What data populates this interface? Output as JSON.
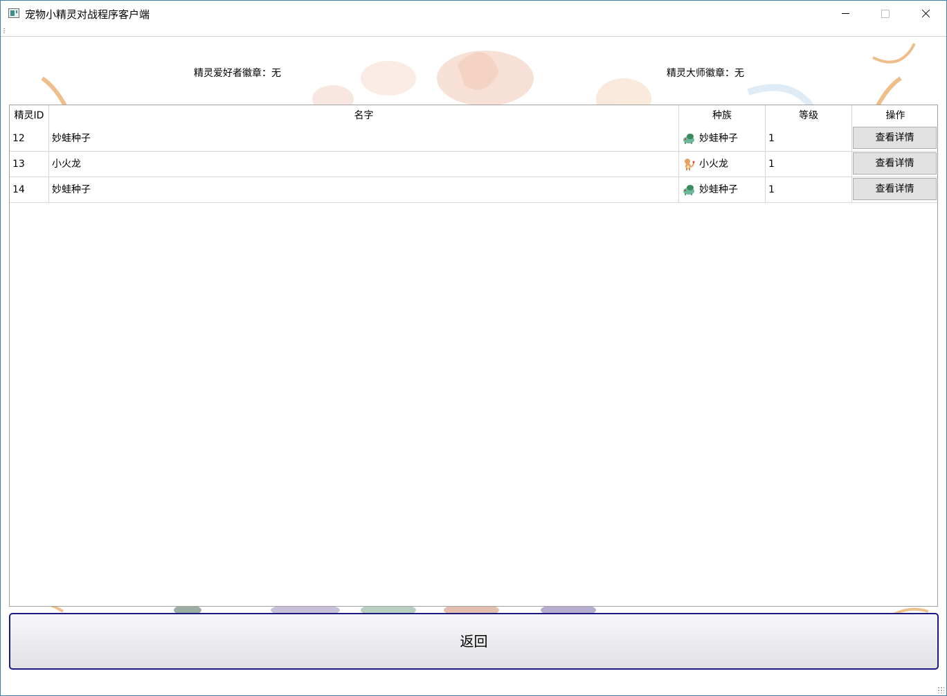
{
  "window": {
    "title": "宠物小精灵对战程序客户端"
  },
  "badges": {
    "fan": "精灵爱好者徽章：无",
    "master": "精灵大师徽章：无"
  },
  "table": {
    "columns": [
      "精灵ID",
      "名字",
      "种族",
      "等级",
      "操作"
    ],
    "rows": [
      {
        "id": "12",
        "name": "妙蛙种子",
        "race": "妙蛙种子",
        "race_icon": "bulbasaur-icon",
        "level": "1",
        "action": "查看详情"
      },
      {
        "id": "13",
        "name": "小火龙",
        "race": "小火龙",
        "race_icon": "charmander-icon",
        "level": "1",
        "action": "查看详情"
      },
      {
        "id": "14",
        "name": "妙蛙种子",
        "race": "妙蛙种子",
        "race_icon": "bulbasaur-icon",
        "level": "1",
        "action": "查看详情"
      }
    ]
  },
  "return_button": "返回",
  "colors": {
    "window_border": "#3c7fb1",
    "return_border": "#1a1a7e",
    "button_bg": "#e1e1e1"
  }
}
